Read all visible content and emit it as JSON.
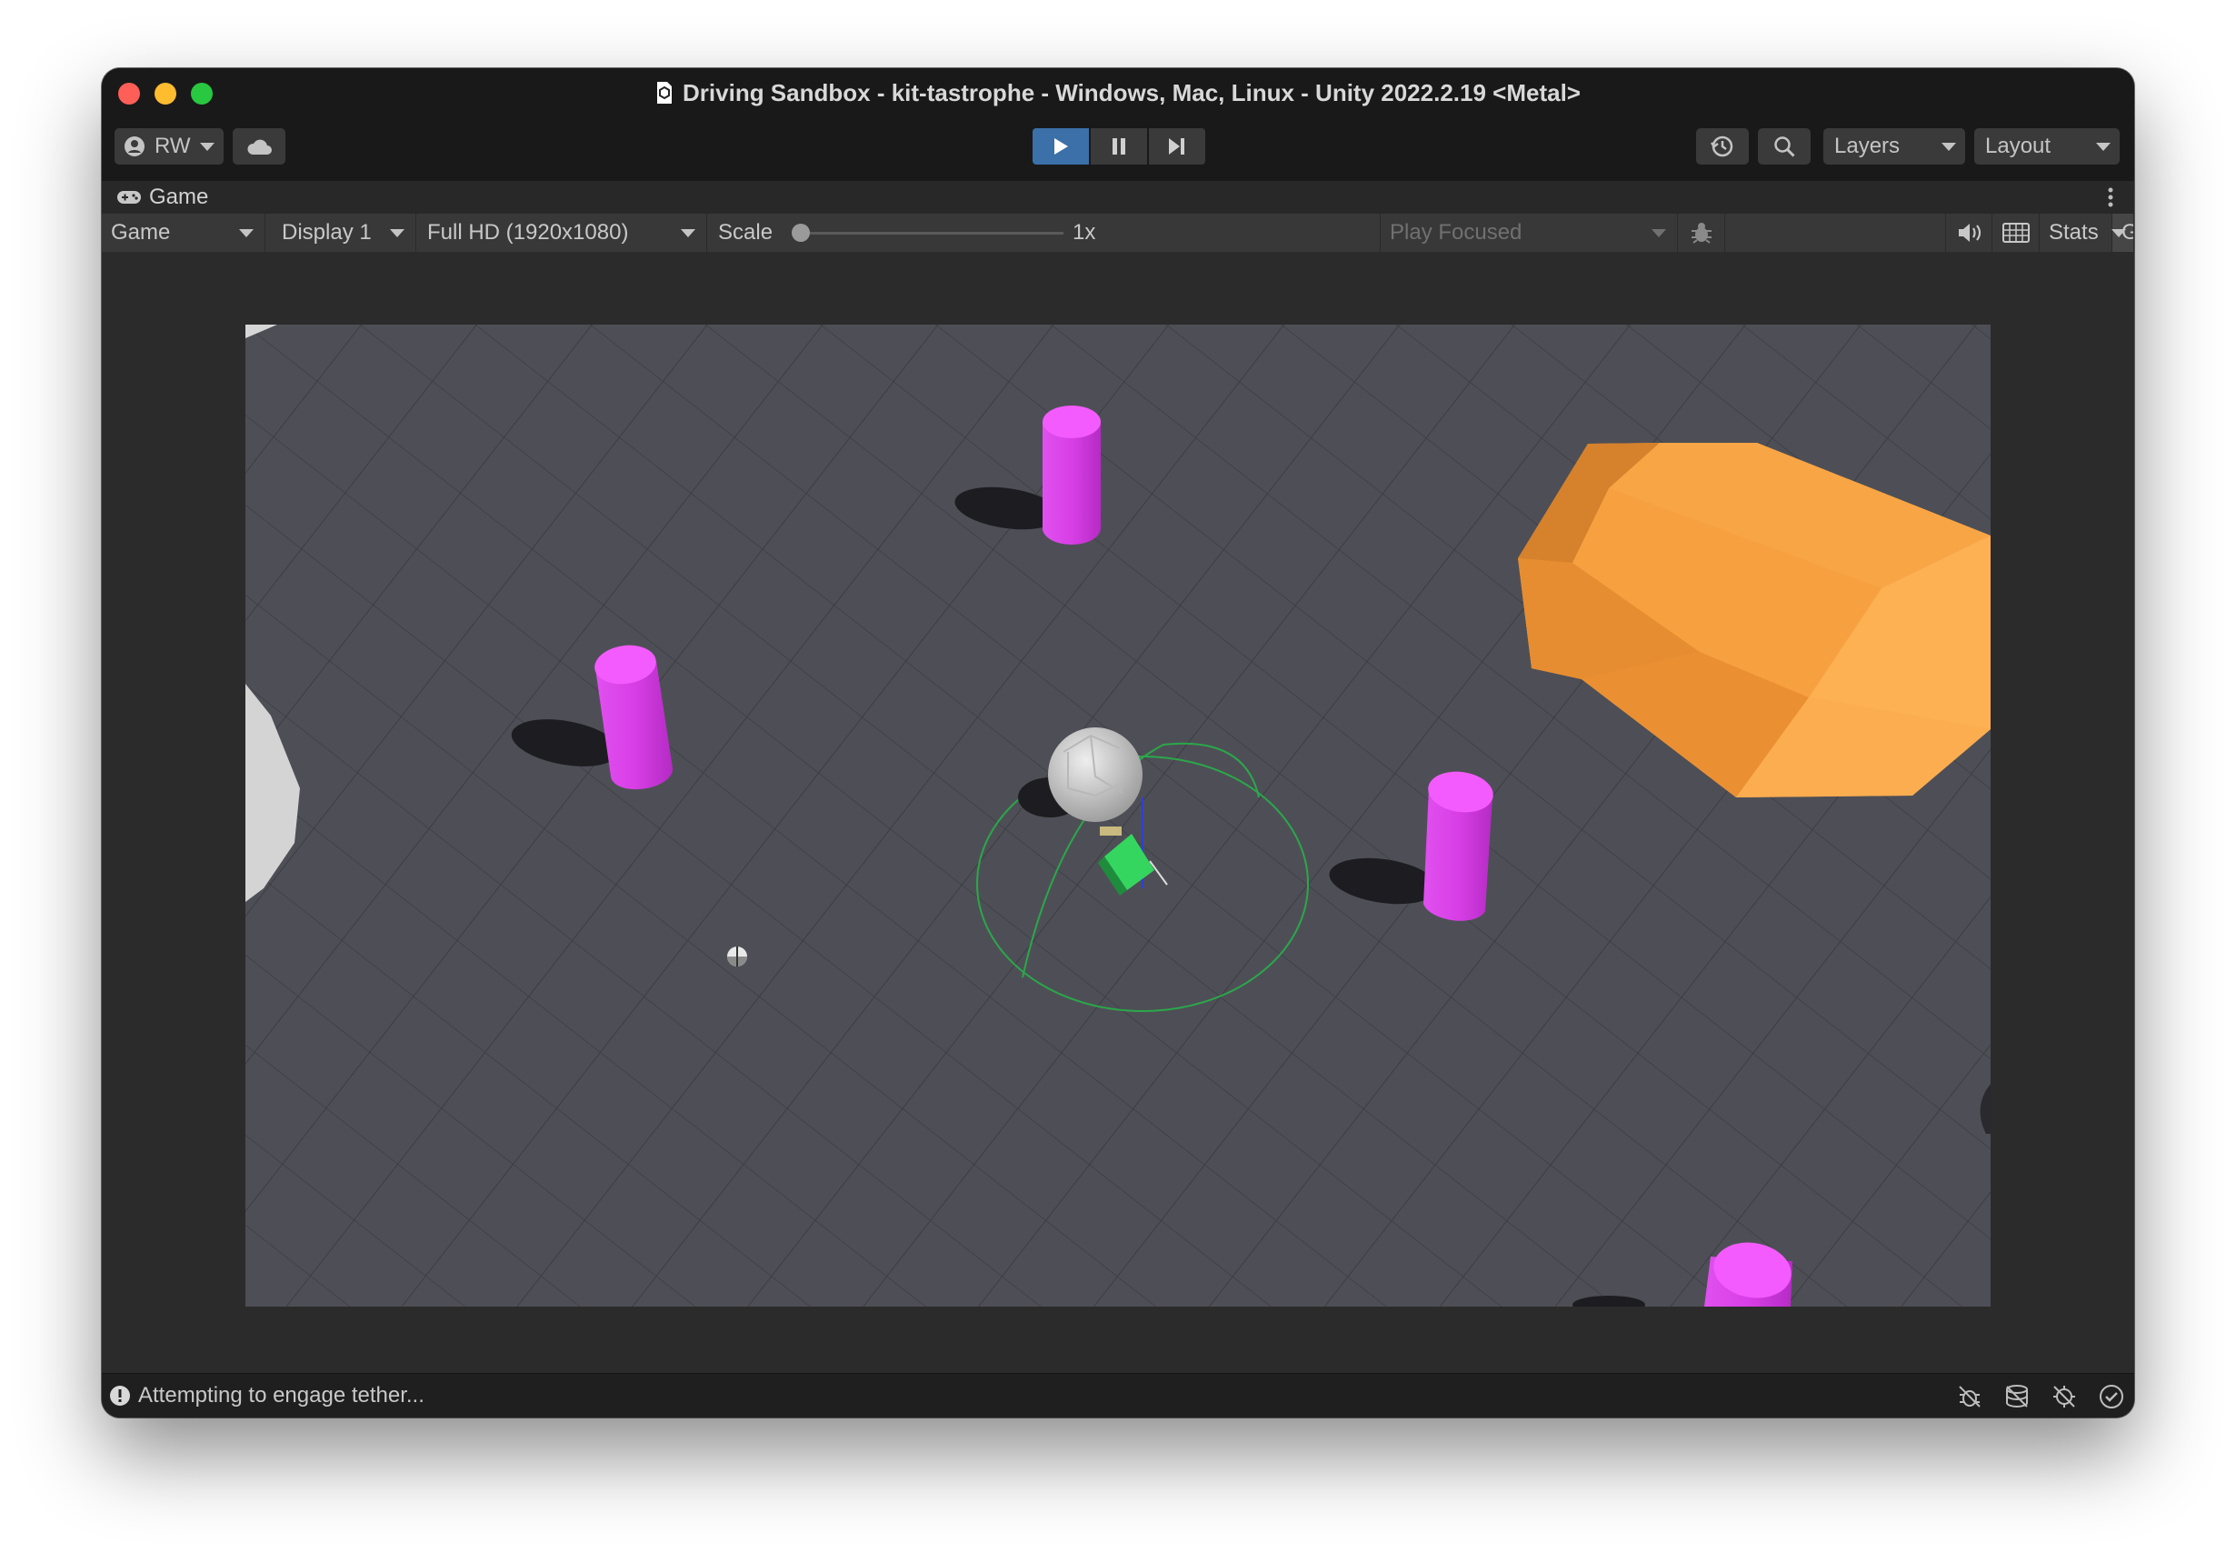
{
  "window": {
    "title": "Driving Sandbox - kit-tastrophe - Windows, Mac, Linux - Unity 2022.2.19 <Metal>"
  },
  "toolbar": {
    "account_label": "RW",
    "layers_label": "Layers",
    "layout_label": "Layout"
  },
  "game_tab": {
    "label": "Game"
  },
  "game_toolbar": {
    "view_select": "Game",
    "display_select": "Display 1",
    "resolution_select": "Full HD (1920x1080)",
    "scale_label": "Scale",
    "scale_value": "1x",
    "scale_fraction": 0.0,
    "play_mode_select": "Play Focused",
    "stats_label": "Stats",
    "gizmos_label": "Gizmos"
  },
  "status": {
    "message": "Attempting to engage tether..."
  },
  "colors": {
    "accent_play": "#3b70a8",
    "ground": "#4e4f56",
    "pillar": "#df40eb",
    "rock_orange": "#f5993a",
    "vehicle_green": "#35d65f"
  }
}
